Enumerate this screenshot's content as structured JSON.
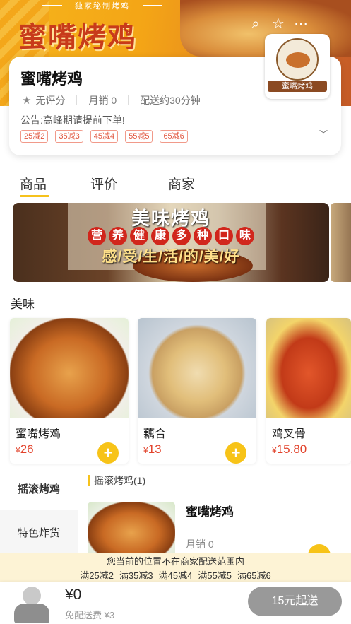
{
  "hero": {
    "subtitle": "独家秘制烤鸡",
    "title": "蜜嘴烤鸡",
    "icons": [
      "search-icon",
      "star-icon",
      "more-icon"
    ]
  },
  "shop": {
    "name": "蜜嘴烤鸡",
    "logo_text": "蜜嘴烤鸡",
    "rating": "无评分",
    "monthly_sales": "月销 0",
    "delivery_time": "配送约30分钟",
    "notice": "公告:高峰期请提前下单!",
    "tags": [
      "25减2",
      "35减3",
      "45减4",
      "55减5",
      "65减6"
    ]
  },
  "tabs": [
    {
      "label": "商品",
      "active": true
    },
    {
      "label": "评价",
      "active": false
    },
    {
      "label": "商家",
      "active": false
    }
  ],
  "banner": {
    "title": "美味烤鸡",
    "pills": [
      "营",
      "养",
      "健",
      "康",
      "多",
      "种",
      "口",
      "味"
    ],
    "slogan": "感/受/生/活/的/美/好"
  },
  "section": {
    "title": "美味"
  },
  "products": [
    {
      "name": "蜜嘴烤鸡",
      "currency": "¥",
      "price": "26"
    },
    {
      "name": "藕合",
      "currency": "¥",
      "price": "13"
    },
    {
      "name": "鸡叉骨",
      "currency": "¥",
      "price": "15.80"
    }
  ],
  "categories": [
    {
      "label": "摇滚烤鸡",
      "active": true
    },
    {
      "label": "特色炸货",
      "active": false
    }
  ],
  "list": {
    "header": "摇滚烤鸡(1)",
    "item": {
      "name": "蜜嘴烤鸡",
      "sales": "月销 0"
    }
  },
  "strip": {
    "message": "您当前的位置不在商家配送范围内",
    "discounts": [
      "满25减2",
      "满35减3",
      "满45减4",
      "满55减5",
      "满65减6"
    ]
  },
  "cart": {
    "total": "¥0",
    "delivery_fee": "免配送费 ¥3",
    "checkout_label": "15元起送"
  },
  "colors": {
    "accent": "#f7c318",
    "price": "#e2432c",
    "hero": "#f4a516"
  }
}
